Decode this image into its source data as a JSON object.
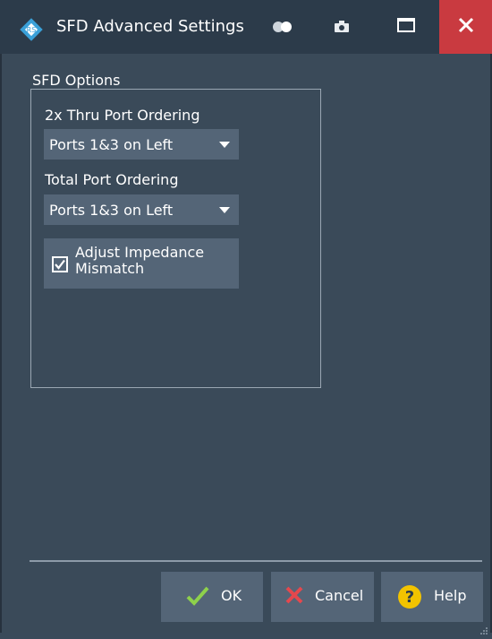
{
  "window": {
    "title": "SFD Advanced Settings",
    "icons": [
      "rs-logo-icon",
      "toggle-icon",
      "camera-icon",
      "maximize-icon",
      "close-icon"
    ],
    "colors": {
      "titlebar": "#2c3b4a",
      "background": "#3a4a59",
      "control": "#546577",
      "close": "#c93a40"
    }
  },
  "sfd_options": {
    "group_label": "SFD Options",
    "thru_ordering": {
      "label": "2x Thru Port Ordering",
      "value": "Ports 1&3 on Left"
    },
    "total_ordering": {
      "label": "Total Port Ordering",
      "value": "Ports 1&3 on Left"
    },
    "adjust_impedance": {
      "label": "Adjust Impedance Mismatch",
      "checked": true
    }
  },
  "buttons": {
    "ok": "OK",
    "cancel": "Cancel",
    "help": "Help"
  }
}
